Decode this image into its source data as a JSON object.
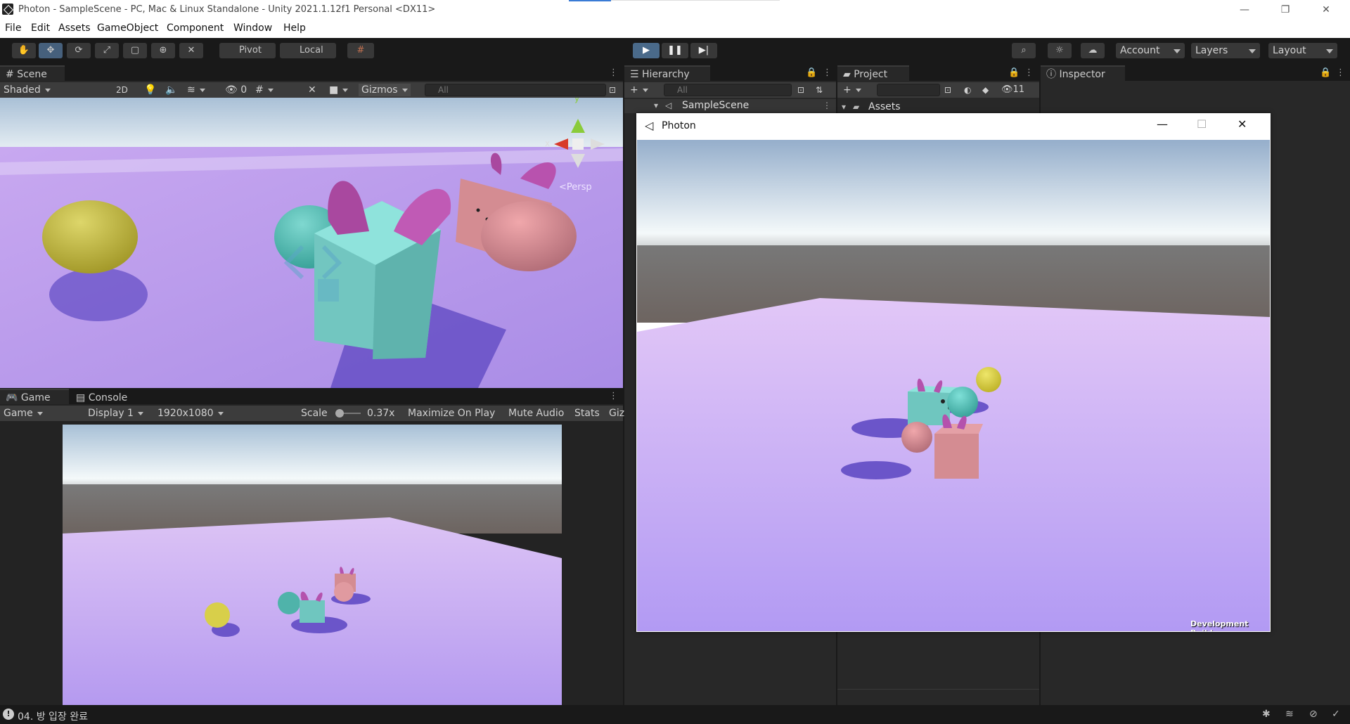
{
  "window": {
    "title": "Photon - SampleScene - PC, Mac & Linux Standalone - Unity 2021.1.12f1 Personal <DX11>",
    "minimize": "—",
    "restore": "❐",
    "close": "✕"
  },
  "menu": [
    "File",
    "Edit",
    "Assets",
    "GameObject",
    "Component",
    "Window",
    "Help"
  ],
  "toolbar": {
    "pivot_label": "Pivot",
    "local_label": "Local",
    "account_label": "Account",
    "layers_label": "Layers",
    "layout_label": "Layout"
  },
  "scene_panel": {
    "tab_label": "Scene",
    "shading_mode": "Shaded",
    "mode_2d": "2D",
    "hidden_count": "0",
    "gizmos_label": "Gizmos",
    "search_placeholder": "All",
    "axis_y": "y",
    "axis_x": "x",
    "persp_label": "<Persp"
  },
  "game_panel": {
    "game_tab": "Game",
    "console_tab": "Console",
    "view_mode": "Game",
    "display": "Display 1",
    "resolution": "1920x1080",
    "scale_label": "Scale",
    "scale_value": "0.37x",
    "maximize_on_play": "Maximize On Play",
    "mute_audio": "Mute Audio",
    "stats": "Stats",
    "gizmos_cut": "Giz"
  },
  "hierarchy": {
    "tab_label": "Hierarchy",
    "search_placeholder": "All",
    "scene_item": "SampleScene"
  },
  "project": {
    "tab_label": "Project",
    "hidden_count": "11",
    "assets_folder": "Assets"
  },
  "inspector": {
    "tab_label": "Inspector"
  },
  "photon_window": {
    "title": "Photon",
    "watermark": "Development Build"
  },
  "status": {
    "message": "04. 방 입장 완료"
  },
  "colors": {
    "accent_play": "#4a6a8a",
    "ground": "#c3a8f5",
    "teal": "#7ad7d0",
    "pink": "#d99a9e",
    "yellow": "#d8cf4a",
    "ears": "#b45bb0"
  }
}
